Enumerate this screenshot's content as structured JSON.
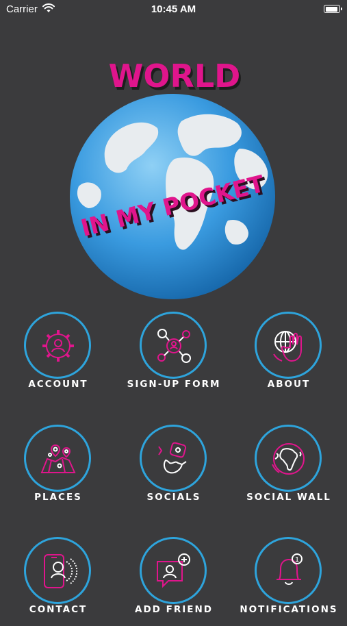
{
  "status_bar": {
    "carrier": "Carrier",
    "time": "10:45 AM"
  },
  "logo": {
    "line1": "WORLD",
    "line2": "IN MY POCKET"
  },
  "menu": [
    {
      "label": "ACCOUNT",
      "icon": "account-gear-icon"
    },
    {
      "label": "SIGN-UP FORM",
      "icon": "signup-network-icon"
    },
    {
      "label": "ABOUT",
      "icon": "globe-hand-icon"
    },
    {
      "label": "PLACES",
      "icon": "map-pins-icon"
    },
    {
      "label": "SOCIALS",
      "icon": "social-chat-icon"
    },
    {
      "label": "SOCIAL WALL",
      "icon": "globe-africa-icon"
    },
    {
      "label": "CONTACT",
      "icon": "phone-contact-icon"
    },
    {
      "label": "ADD FRIEND",
      "icon": "add-friend-icon"
    },
    {
      "label": "NOTIFICATIONS",
      "icon": "bell-icon"
    }
  ],
  "colors": {
    "background": "#3b3b3d",
    "accent": "#e0158c",
    "ring": "#2ea4dc",
    "label": "#ffffff"
  },
  "notification_badge": "1"
}
